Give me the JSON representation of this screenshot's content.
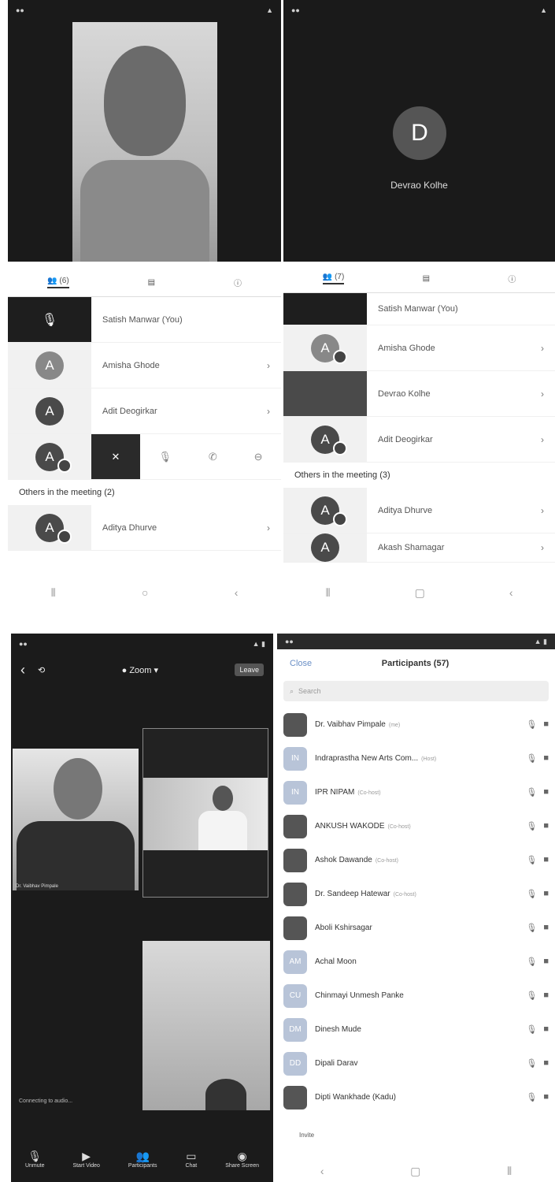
{
  "panel1": {
    "participants_tab": "(6)",
    "rows": [
      {
        "name": "Satish Manwar (You)",
        "type": "video"
      },
      {
        "name": "Amisha Ghode",
        "type": "avatar",
        "initial": "A"
      },
      {
        "name": "Adit Deogirkar",
        "type": "avatar",
        "initial": "A"
      }
    ],
    "action_row": {
      "initial": "A",
      "close": "✕"
    },
    "others_header": "Others in the meeting (2)",
    "others": [
      {
        "name": "Aditya Dhurve",
        "initial": "A"
      }
    ]
  },
  "panel2": {
    "speaker_initial": "D",
    "speaker_name": "Devrao Kolhe",
    "participants_tab": "(7)",
    "rows": [
      {
        "name": "Satish Manwar (You)"
      },
      {
        "name": "Amisha Ghode",
        "initial": "A"
      },
      {
        "name": "Devrao Kolhe"
      },
      {
        "name": "Adit Deogirkar",
        "initial": "A"
      }
    ],
    "others_header": "Others in the meeting (3)",
    "others": [
      {
        "name": "Aditya Dhurve",
        "initial": "A"
      },
      {
        "name": "Akash Shamagar",
        "initial": "A"
      }
    ]
  },
  "panel3": {
    "zoom_label": "● Zoom ▾",
    "leave": "Leave",
    "main_caption": "Dr. Vaibhav Pimpale",
    "audio_status": "Connecting to audio...",
    "toolbar": [
      "Unmute",
      "Start Video",
      "Participants",
      "Chat",
      "Share Screen"
    ]
  },
  "panel4": {
    "close": "Close",
    "title": "Participants (57)",
    "search_placeholder": "Search",
    "invite": "Invite",
    "participants": [
      {
        "name": "Dr. Vaibhav Pimpale",
        "tag": "(me)",
        "initials": "",
        "photo": true
      },
      {
        "name": "Indraprastha New Arts Com...",
        "tag": "(Host)",
        "initials": "IN",
        "photo": false
      },
      {
        "name": "IPR NIPAM",
        "tag": "(Co-host)",
        "initials": "IN",
        "photo": false
      },
      {
        "name": "ANKUSH WAKODE",
        "tag": "(Co-host)",
        "initials": "",
        "photo": true
      },
      {
        "name": "Ashok Dawande",
        "tag": "(Co-host)",
        "initials": "",
        "photo": true
      },
      {
        "name": "Dr. Sandeep Hatewar",
        "tag": "(Co-host)",
        "initials": "",
        "photo": true
      },
      {
        "name": "Aboli Kshirsagar",
        "tag": "",
        "initials": "",
        "photo": true
      },
      {
        "name": "Achal Moon",
        "tag": "",
        "initials": "AM",
        "photo": false
      },
      {
        "name": "Chinmayi Unmesh Panke",
        "tag": "",
        "initials": "CU",
        "photo": false
      },
      {
        "name": "Dinesh Mude",
        "tag": "",
        "initials": "DM",
        "photo": false
      },
      {
        "name": "Dipali Darav",
        "tag": "",
        "initials": "DD",
        "photo": false
      },
      {
        "name": "Dipti Wankhade (Kadu)",
        "tag": "",
        "initials": "",
        "photo": true
      }
    ]
  }
}
